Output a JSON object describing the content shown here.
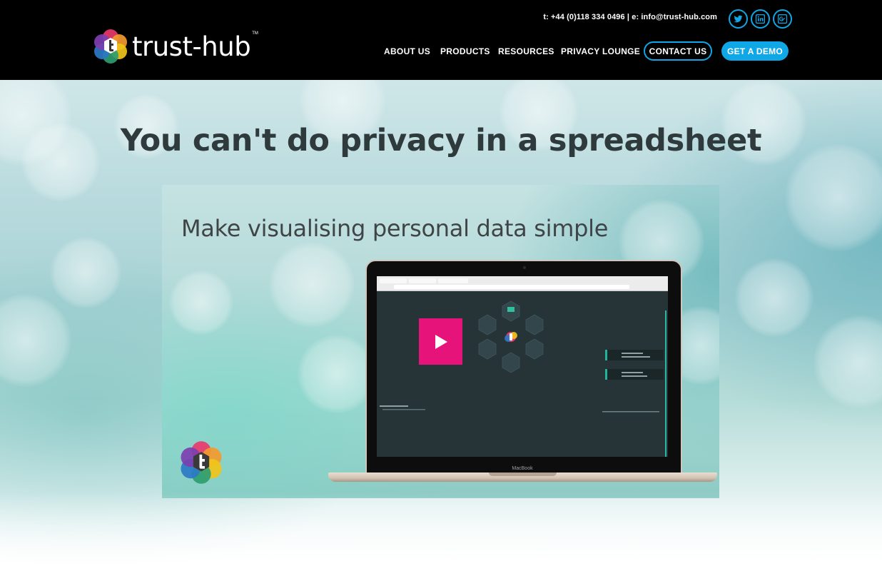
{
  "header": {
    "brand": "trust-hub",
    "trademark": "TM",
    "contact_line": "t: +44 (0)118 334 0496 | e: info@trust-hub.com",
    "social": [
      "twitter-icon",
      "linkedin-icon",
      "google-plus-icon"
    ],
    "nav": {
      "about": "ABOUT US",
      "products": "PRODUCTS",
      "resources": "RESOURCES",
      "privacy_lounge": "PRIVACY LOUNGE"
    },
    "contact_button": "CONTACT US",
    "demo_button": "GET A DEMO"
  },
  "hero": {
    "title": "You can't do privacy in a spreadsheet",
    "video": {
      "heading": "Make visualising personal data simple",
      "laptop_label": "MacBook",
      "play_icon": "play-icon"
    }
  },
  "colors": {
    "header_bg": "#000000",
    "accent_blue": "#0fa7e6",
    "play_pink": "#e5137a",
    "title_text": "#2f3a3c"
  }
}
